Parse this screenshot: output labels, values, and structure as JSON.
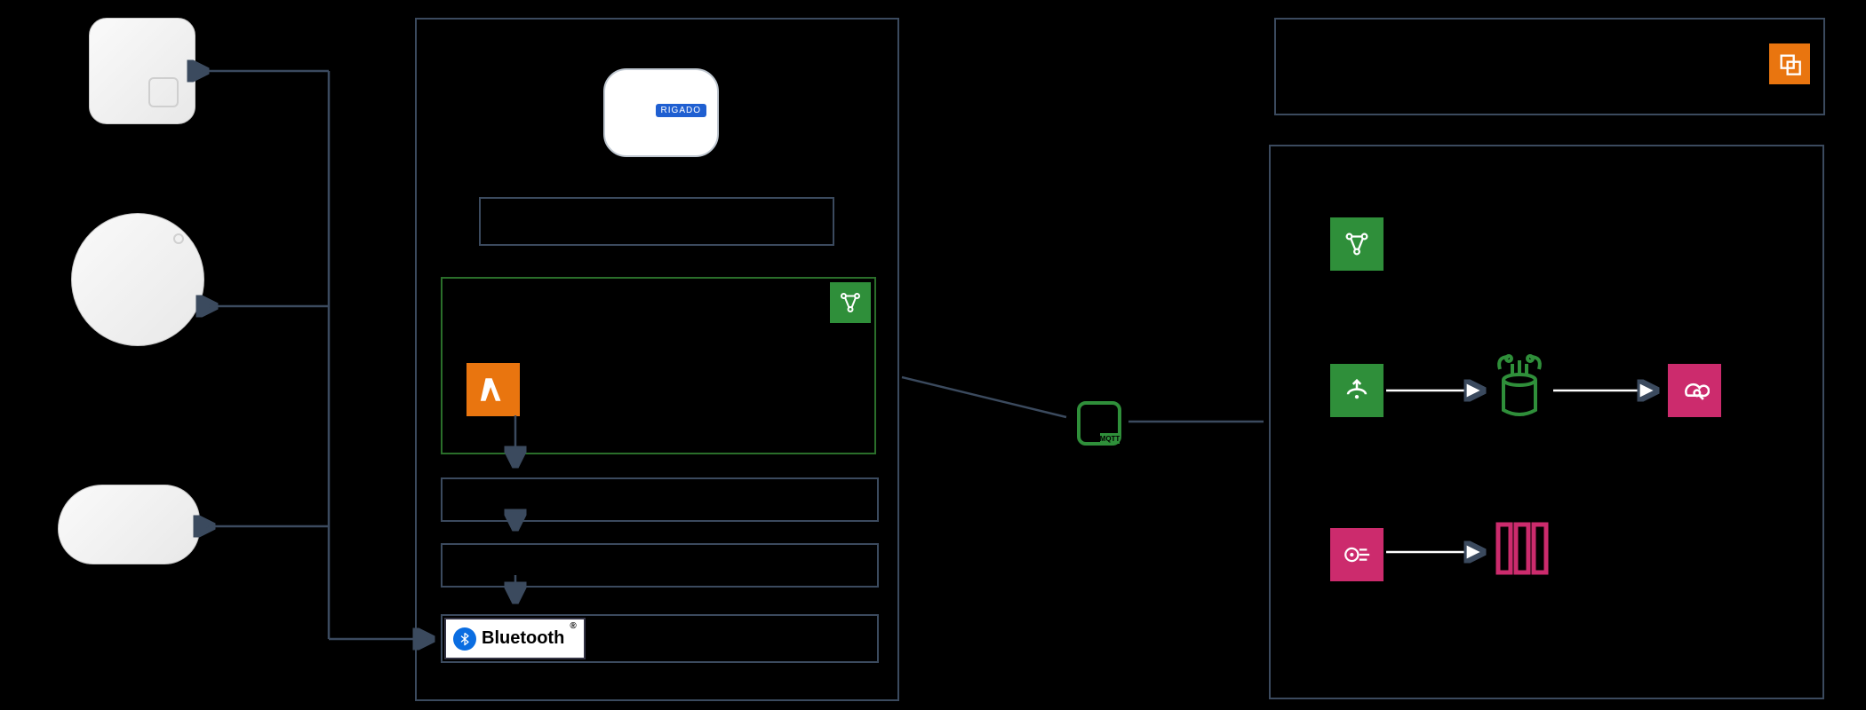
{
  "sensors": [
    {
      "name": "square-sensor",
      "kind": "rounded-sq"
    },
    {
      "name": "circle-sensor",
      "kind": "circle"
    },
    {
      "name": "blob-sensor",
      "kind": "blob"
    }
  ],
  "gateway": {
    "brand_label": "RIGADO"
  },
  "gateway_box": {
    "rows": [
      {
        "label": ""
      },
      {
        "label": ""
      },
      {
        "label": ""
      },
      {
        "label": ""
      }
    ]
  },
  "greengrass_label": "",
  "lambda_label": "",
  "mqtt_label": "MQTT",
  "bluetooth_label": "Bluetooth",
  "cloud_top": {
    "title": ""
  },
  "cloud_main": {
    "items": {
      "iot_core": "",
      "iot_rule": "",
      "iot_analytics_bucket": "",
      "iot_analytics_cloud": "",
      "iot_management": "",
      "glue_or_analytics": ""
    }
  }
}
